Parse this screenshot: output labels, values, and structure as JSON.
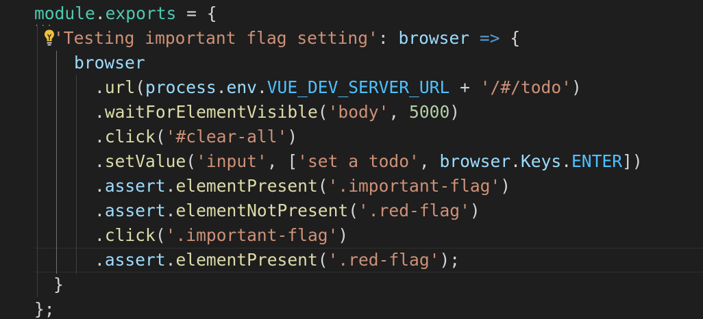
{
  "code": {
    "lines": [
      [
        {
          "t": "module",
          "c": "mod"
        },
        {
          "t": ".",
          "c": "p"
        },
        {
          "t": "exports",
          "c": "mod"
        },
        {
          "t": " = {",
          "c": "p"
        }
      ],
      [
        {
          "t": "'Testing important flag setting'",
          "c": "str"
        },
        {
          "t": ": ",
          "c": "p"
        },
        {
          "t": "browser",
          "c": "id"
        },
        {
          "t": " ",
          "c": "p"
        },
        {
          "t": "=>",
          "c": "kw"
        },
        {
          "t": " {",
          "c": "p"
        }
      ],
      [
        {
          "t": "browser",
          "c": "id"
        }
      ],
      [
        {
          "t": ".",
          "c": "p"
        },
        {
          "t": "url",
          "c": "fn"
        },
        {
          "t": "(",
          "c": "p"
        },
        {
          "t": "process",
          "c": "id"
        },
        {
          "t": ".",
          "c": "p"
        },
        {
          "t": "env",
          "c": "id"
        },
        {
          "t": ".",
          "c": "p"
        },
        {
          "t": "VUE_DEV_SERVER_URL",
          "c": "const"
        },
        {
          "t": " + ",
          "c": "p"
        },
        {
          "t": "'/#/todo'",
          "c": "str"
        },
        {
          "t": ")",
          "c": "p"
        }
      ],
      [
        {
          "t": ".",
          "c": "p"
        },
        {
          "t": "waitForElementVisible",
          "c": "fn"
        },
        {
          "t": "(",
          "c": "p"
        },
        {
          "t": "'body'",
          "c": "str"
        },
        {
          "t": ", ",
          "c": "p"
        },
        {
          "t": "5000",
          "c": "num"
        },
        {
          "t": ")",
          "c": "p"
        }
      ],
      [
        {
          "t": ".",
          "c": "p"
        },
        {
          "t": "click",
          "c": "fn"
        },
        {
          "t": "(",
          "c": "p"
        },
        {
          "t": "'#clear-all'",
          "c": "str"
        },
        {
          "t": ")",
          "c": "p"
        }
      ],
      [
        {
          "t": ".",
          "c": "p"
        },
        {
          "t": "setValue",
          "c": "fn"
        },
        {
          "t": "(",
          "c": "p"
        },
        {
          "t": "'input'",
          "c": "str"
        },
        {
          "t": ", [",
          "c": "p"
        },
        {
          "t": "'set a todo'",
          "c": "str"
        },
        {
          "t": ", ",
          "c": "p"
        },
        {
          "t": "browser",
          "c": "id"
        },
        {
          "t": ".",
          "c": "p"
        },
        {
          "t": "Keys",
          "c": "id"
        },
        {
          "t": ".",
          "c": "p"
        },
        {
          "t": "ENTER",
          "c": "const"
        },
        {
          "t": "])",
          "c": "p"
        }
      ],
      [
        {
          "t": ".",
          "c": "p"
        },
        {
          "t": "assert",
          "c": "id"
        },
        {
          "t": ".",
          "c": "p"
        },
        {
          "t": "elementPresent",
          "c": "fn"
        },
        {
          "t": "(",
          "c": "p"
        },
        {
          "t": "'.important-flag'",
          "c": "str"
        },
        {
          "t": ")",
          "c": "p"
        }
      ],
      [
        {
          "t": ".",
          "c": "p"
        },
        {
          "t": "assert",
          "c": "id"
        },
        {
          "t": ".",
          "c": "p"
        },
        {
          "t": "elementNotPresent",
          "c": "fn"
        },
        {
          "t": "(",
          "c": "p"
        },
        {
          "t": "'.red-flag'",
          "c": "str"
        },
        {
          "t": ")",
          "c": "p"
        }
      ],
      [
        {
          "t": ".",
          "c": "p"
        },
        {
          "t": "click",
          "c": "fn"
        },
        {
          "t": "(",
          "c": "p"
        },
        {
          "t": "'.important-flag'",
          "c": "str"
        },
        {
          "t": ")",
          "c": "p"
        }
      ],
      [
        {
          "t": ".",
          "c": "p"
        },
        {
          "t": "assert",
          "c": "id"
        },
        {
          "t": ".",
          "c": "p"
        },
        {
          "t": "elementPresent",
          "c": "fn"
        },
        {
          "t": "(",
          "c": "p"
        },
        {
          "t": "'.red-flag'",
          "c": "str"
        },
        {
          "t": ");",
          "c": "p"
        }
      ],
      [
        {
          "t": "}",
          "c": "p"
        }
      ],
      [
        {
          "t": "};",
          "c": "p"
        }
      ]
    ]
  },
  "icons": {
    "lightbulb": "lightbulb-icon",
    "fold_dots": "..."
  },
  "colors": {
    "background": "#1e1e1e",
    "string": "#ce9178",
    "function": "#dcdcaa",
    "identifier": "#9cdcfe",
    "keyword": "#569cd6",
    "constant": "#4fc1ff",
    "number": "#b5cea8",
    "module": "#4ec9b0"
  }
}
